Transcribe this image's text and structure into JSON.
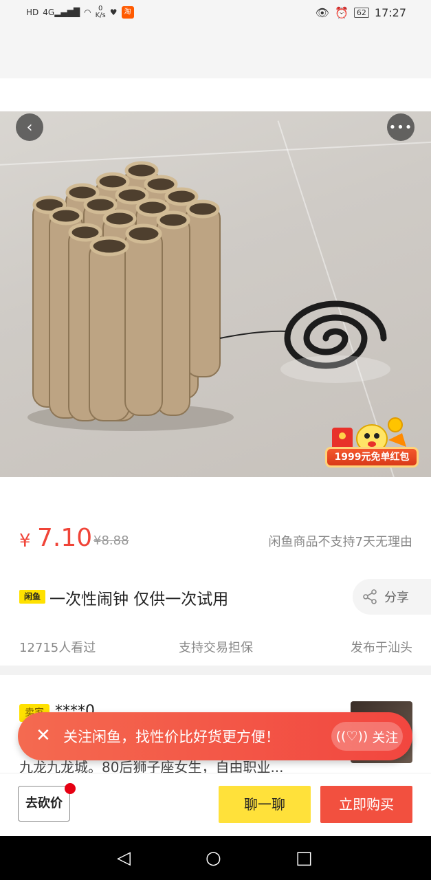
{
  "status_bar": {
    "hd": "HD",
    "network": "4G",
    "speed_value": "0",
    "speed_unit": "K/s",
    "app_badge": "淘",
    "battery": "62",
    "time": "17:27"
  },
  "product": {
    "promo_badge": "1999元免单红包",
    "price_symbol": "¥",
    "price": "7.10",
    "original_price": "¥8.88",
    "return_policy": "闲鱼商品不支持7天无理由",
    "platform_tag": "闲鱼",
    "title": "一次性闹钟 仅供一次试用",
    "share_label": "分享",
    "views": "12715人看过",
    "guarantee": "支持交易担保",
    "location": "发布于汕头"
  },
  "seller": {
    "tag": "卖家",
    "name": "****0",
    "desc": "九龙九龙城。80后狮子座女生，自由职业..."
  },
  "follow_banner": {
    "text": "关注闲鱼，找性价比好货更方便！",
    "button": "关注"
  },
  "bottom_bar": {
    "bargain": "去砍价",
    "chat": "聊一聊",
    "buy": "立即购买"
  },
  "colors": {
    "price_red": "#f04438",
    "brand_yellow": "#ffe100",
    "buy_red": "#f2503f"
  }
}
